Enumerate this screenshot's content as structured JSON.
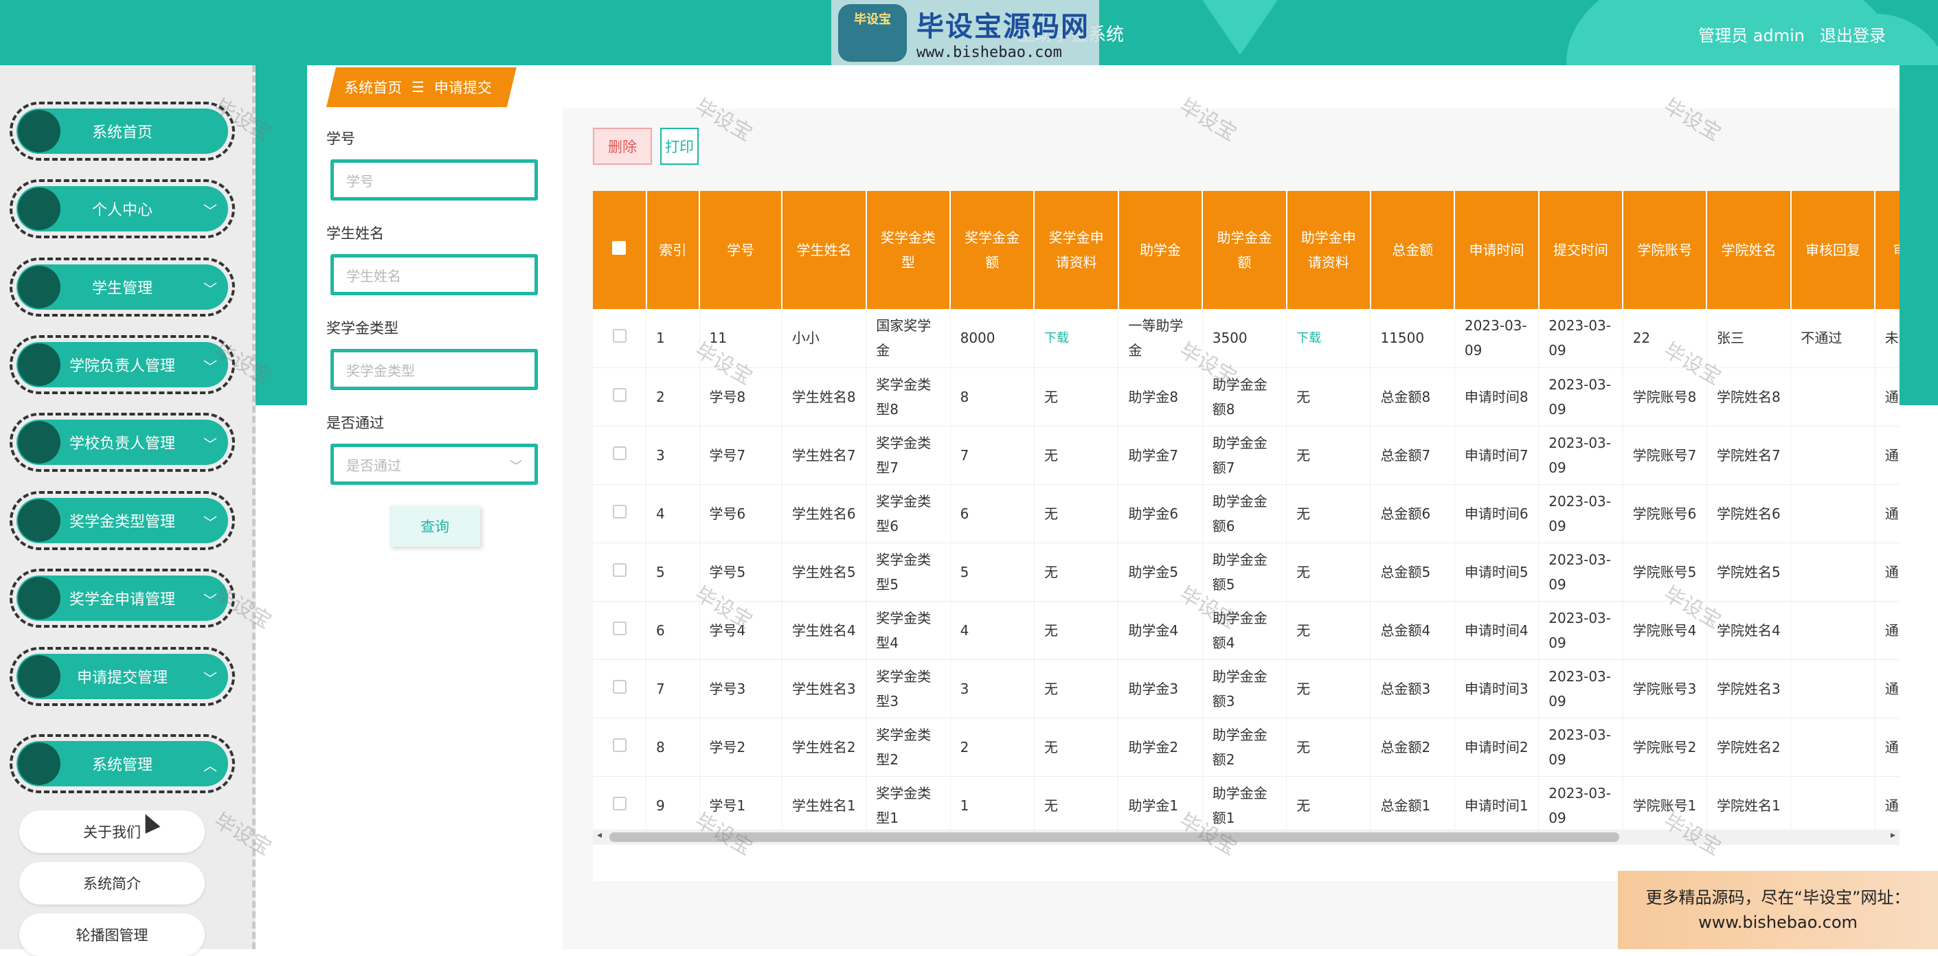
{
  "header": {
    "title_partial": "生助学金系统",
    "logo_badge": "毕设宝",
    "logo_title": "毕设宝源码网",
    "logo_url": "www.bishebao.com",
    "user_label": "管理员 admin",
    "logout_label": "退出登录"
  },
  "sidebar": {
    "items": [
      {
        "label": "系统首页",
        "arrow": ""
      },
      {
        "label": "个人中心",
        "arrow": "﹀"
      },
      {
        "label": "学生管理",
        "arrow": "﹀"
      },
      {
        "label": "学院负责人管理",
        "arrow": "﹀"
      },
      {
        "label": "学校负责人管理",
        "arrow": "﹀"
      },
      {
        "label": "奖学金类型管理",
        "arrow": "﹀"
      },
      {
        "label": "奖学金申请管理",
        "arrow": "﹀"
      },
      {
        "label": "申请提交管理",
        "arrow": "﹀"
      },
      {
        "label": "系统管理",
        "arrow": "︿"
      }
    ],
    "sub_items": [
      "关于我们",
      "系统简介",
      "轮播图管理"
    ]
  },
  "breadcrumb": {
    "home": "系统首页",
    "separator": "☰",
    "current": "申请提交"
  },
  "search": {
    "student_no_label": "学号",
    "student_no_placeholder": "学号",
    "student_name_label": "学生姓名",
    "student_name_placeholder": "学生姓名",
    "type_label": "奖学金类型",
    "type_placeholder": "奖学金类型",
    "pass_label": "是否通过",
    "pass_placeholder": "是否通过",
    "query_button": "查询"
  },
  "toolbar": {
    "delete_label": "删除",
    "print_label": "打印"
  },
  "table": {
    "columns": [
      "索引",
      "学号",
      "学生姓名",
      "奖学金类型",
      "奖学金金额",
      "奖学金申请资料",
      "助学金",
      "助学金金额",
      "助学金申请资料",
      "总金额",
      "申请时间",
      "提交时间",
      "学院账号",
      "学院姓名",
      "审核回复",
      "审核状态"
    ],
    "rows": [
      [
        "1",
        "11",
        "小小",
        "国家奖学金",
        "8000",
        "下载",
        "一等助学金",
        "3500",
        "下载",
        "11500",
        "2023-03-09",
        "2023-03-09",
        "22",
        "张三",
        "不通过",
        "未通过"
      ],
      [
        "2",
        "学号8",
        "学生姓名8",
        "奖学金类型8",
        "8",
        "无",
        "助学金8",
        "助学金金额8",
        "无",
        "总金额8",
        "申请时间8",
        "2023-03-09",
        "学院账号8",
        "学院姓名8",
        "",
        "通过"
      ],
      [
        "3",
        "学号7",
        "学生姓名7",
        "奖学金类型7",
        "7",
        "无",
        "助学金7",
        "助学金金额7",
        "无",
        "总金额7",
        "申请时间7",
        "2023-03-09",
        "学院账号7",
        "学院姓名7",
        "",
        "通过"
      ],
      [
        "4",
        "学号6",
        "学生姓名6",
        "奖学金类型6",
        "6",
        "无",
        "助学金6",
        "助学金金额6",
        "无",
        "总金额6",
        "申请时间6",
        "2023-03-09",
        "学院账号6",
        "学院姓名6",
        "",
        "通过"
      ],
      [
        "5",
        "学号5",
        "学生姓名5",
        "奖学金类型5",
        "5",
        "无",
        "助学金5",
        "助学金金额5",
        "无",
        "总金额5",
        "申请时间5",
        "2023-03-09",
        "学院账号5",
        "学院姓名5",
        "",
        "通过"
      ],
      [
        "6",
        "学号4",
        "学生姓名4",
        "奖学金类型4",
        "4",
        "无",
        "助学金4",
        "助学金金额4",
        "无",
        "总金额4",
        "申请时间4",
        "2023-03-09",
        "学院账号4",
        "学院姓名4",
        "",
        "通过"
      ],
      [
        "7",
        "学号3",
        "学生姓名3",
        "奖学金类型3",
        "3",
        "无",
        "助学金3",
        "助学金金额3",
        "无",
        "总金额3",
        "申请时间3",
        "2023-03-09",
        "学院账号3",
        "学院姓名3",
        "",
        "通过"
      ],
      [
        "8",
        "学号2",
        "学生姓名2",
        "奖学金类型2",
        "2",
        "无",
        "助学金2",
        "助学金金额2",
        "无",
        "总金额2",
        "申请时间2",
        "2023-03-09",
        "学院账号2",
        "学院姓名2",
        "",
        "通过"
      ],
      [
        "9",
        "学号1",
        "学生姓名1",
        "奖学金类型1",
        "1",
        "无",
        "助学金1",
        "助学金金额1",
        "无",
        "总金额1",
        "申请时间1",
        "2023-03-09",
        "学院账号1",
        "学院姓名1",
        "",
        "通过"
      ]
    ]
  },
  "watermark": "毕设宝",
  "promo": {
    "line1": "更多精品源码，尽在“毕设宝”网址：",
    "line2": "www.bishebao.com"
  },
  "colors": {
    "primary": "#1eb7a2",
    "accent": "#f28c0a",
    "dark_dot": "#0e5f52",
    "link": "#1eb7a2"
  }
}
